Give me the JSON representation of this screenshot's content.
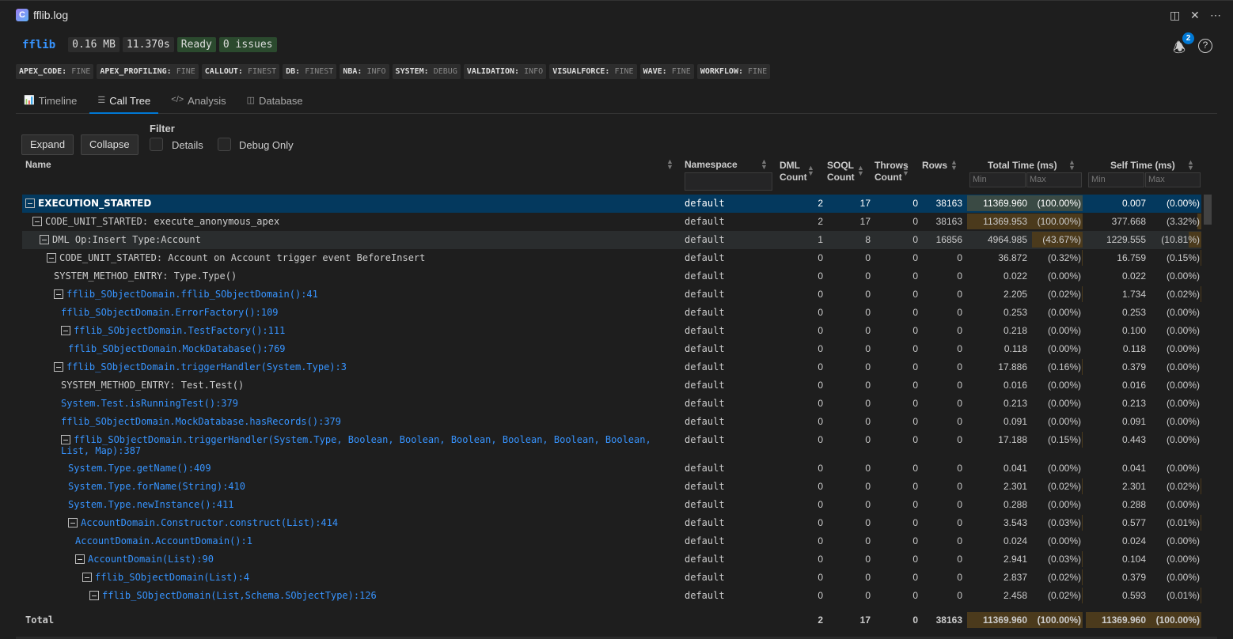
{
  "window": {
    "title": "fflib.log",
    "badge_count": "2"
  },
  "header": {
    "app": "fflib",
    "size": "0.16 MB",
    "duration": "11.370s",
    "status": "Ready",
    "issues": "0 issues"
  },
  "levels": [
    {
      "k": "APEX_CODE:",
      "v": "FINE"
    },
    {
      "k": "APEX_PROFILING:",
      "v": "FINE"
    },
    {
      "k": "CALLOUT:",
      "v": "FINEST"
    },
    {
      "k": "DB:",
      "v": "FINEST"
    },
    {
      "k": "NBA:",
      "v": "INFO"
    },
    {
      "k": "SYSTEM:",
      "v": "DEBUG"
    },
    {
      "k": "VALIDATION:",
      "v": "INFO"
    },
    {
      "k": "VISUALFORCE:",
      "v": "FINE"
    },
    {
      "k": "WAVE:",
      "v": "FINE"
    },
    {
      "k": "WORKFLOW:",
      "v": "FINE"
    }
  ],
  "tabs": [
    {
      "label": "Timeline",
      "icon": "chart-icon"
    },
    {
      "label": "Call Tree",
      "icon": "tree-icon",
      "active": true
    },
    {
      "label": "Analysis",
      "icon": "code-icon"
    },
    {
      "label": "Database",
      "icon": "database-icon"
    }
  ],
  "toolbar": {
    "expand": "Expand",
    "collapse": "Collapse",
    "filter": "Filter",
    "details": "Details",
    "debug_only": "Debug Only"
  },
  "columns": {
    "name": "Name",
    "namespace": "Namespace",
    "dml1": "DML",
    "dml2": "Count",
    "soql1": "SOQL",
    "soql2": "Count",
    "throws1": "Throws",
    "throws2": "Count",
    "rows": "Rows",
    "total": "Total Time (ms)",
    "self": "Self Time (ms)",
    "min": "Min",
    "max": "Max"
  },
  "colors": {
    "selected": "#04395e",
    "link": "#3794ff",
    "bar": "#4b3a1c"
  },
  "rows": [
    {
      "lvl": 0,
      "t": 1,
      "n": "EXECUTION_STARTED",
      "ns": "default",
      "dml": "2",
      "soql": "17",
      "thr": "0",
      "rows": "38163",
      "tt": "11369.960",
      "tp": "(100.00%)",
      "tpv": 100,
      "st": "0.007",
      "sp": "(0.00%)",
      "spv": 0,
      "sel": 1
    },
    {
      "lvl": 1,
      "t": 1,
      "n": "CODE_UNIT_STARTED: execute_anonymous_apex",
      "ns": "default",
      "dml": "2",
      "soql": "17",
      "thr": "0",
      "rows": "38163",
      "tt": "11369.953",
      "tp": "(100.00%)",
      "tpv": 100,
      "st": "377.668",
      "sp": "(3.32%)",
      "spv": 3.32
    },
    {
      "lvl": 2,
      "t": 1,
      "n": "DML Op:Insert Type:Account",
      "ns": "default",
      "dml": "1",
      "soql": "8",
      "thr": "0",
      "rows": "16856",
      "tt": "4964.985",
      "tp": "(43.67%)",
      "tpv": 43.67,
      "st": "1229.555",
      "sp": "(10.81%)",
      "spv": 10.81,
      "hov": 1
    },
    {
      "lvl": 3,
      "t": 1,
      "n": "CODE_UNIT_STARTED: Account on Account trigger event BeforeInsert",
      "ns": "default",
      "dml": "0",
      "soql": "0",
      "thr": "0",
      "rows": "0",
      "tt": "36.872",
      "tp": "(0.32%)",
      "tpv": 0.32,
      "st": "16.759",
      "sp": "(0.15%)",
      "spv": 0.15
    },
    {
      "lvl": 4,
      "t": 0,
      "n": "SYSTEM_METHOD_ENTRY: Type.Type()",
      "ns": "default",
      "dml": "0",
      "soql": "0",
      "thr": "0",
      "rows": "0",
      "tt": "0.022",
      "tp": "(0.00%)",
      "tpv": 0,
      "st": "0.022",
      "sp": "(0.00%)",
      "spv": 0
    },
    {
      "lvl": 4,
      "t": 1,
      "b": 1,
      "n": "fflib_SObjectDomain.fflib_SObjectDomain():41",
      "ns": "default",
      "dml": "0",
      "soql": "0",
      "thr": "0",
      "rows": "0",
      "tt": "2.205",
      "tp": "(0.02%)",
      "tpv": 0.02,
      "st": "1.734",
      "sp": "(0.02%)",
      "spv": 0.02
    },
    {
      "lvl": 5,
      "t": 0,
      "b": 1,
      "n": "fflib_SObjectDomain.ErrorFactory():109",
      "ns": "default",
      "dml": "0",
      "soql": "0",
      "thr": "0",
      "rows": "0",
      "tt": "0.253",
      "tp": "(0.00%)",
      "tpv": 0,
      "st": "0.253",
      "sp": "(0.00%)",
      "spv": 0
    },
    {
      "lvl": 5,
      "t": 1,
      "b": 1,
      "n": "fflib_SObjectDomain.TestFactory():111",
      "ns": "default",
      "dml": "0",
      "soql": "0",
      "thr": "0",
      "rows": "0",
      "tt": "0.218",
      "tp": "(0.00%)",
      "tpv": 0,
      "st": "0.100",
      "sp": "(0.00%)",
      "spv": 0
    },
    {
      "lvl": 6,
      "t": 0,
      "b": 1,
      "n": "fflib_SObjectDomain.MockDatabase():769",
      "ns": "default",
      "dml": "0",
      "soql": "0",
      "thr": "0",
      "rows": "0",
      "tt": "0.118",
      "tp": "(0.00%)",
      "tpv": 0,
      "st": "0.118",
      "sp": "(0.00%)",
      "spv": 0
    },
    {
      "lvl": 4,
      "t": 1,
      "b": 1,
      "n": "fflib_SObjectDomain.triggerHandler(System.Type):3",
      "ns": "default",
      "dml": "0",
      "soql": "0",
      "thr": "0",
      "rows": "0",
      "tt": "17.886",
      "tp": "(0.16%)",
      "tpv": 0.16,
      "st": "0.379",
      "sp": "(0.00%)",
      "spv": 0
    },
    {
      "lvl": 5,
      "t": 0,
      "n": "SYSTEM_METHOD_ENTRY: Test.Test()",
      "ns": "default",
      "dml": "0",
      "soql": "0",
      "thr": "0",
      "rows": "0",
      "tt": "0.016",
      "tp": "(0.00%)",
      "tpv": 0,
      "st": "0.016",
      "sp": "(0.00%)",
      "spv": 0
    },
    {
      "lvl": 5,
      "t": 0,
      "b": 1,
      "n": "System.Test.isRunningTest():379",
      "ns": "default",
      "dml": "0",
      "soql": "0",
      "thr": "0",
      "rows": "0",
      "tt": "0.213",
      "tp": "(0.00%)",
      "tpv": 0,
      "st": "0.213",
      "sp": "(0.00%)",
      "spv": 0
    },
    {
      "lvl": 5,
      "t": 0,
      "b": 1,
      "n": "fflib_SObjectDomain.MockDatabase.hasRecords():379",
      "ns": "default",
      "dml": "0",
      "soql": "0",
      "thr": "0",
      "rows": "0",
      "tt": "0.091",
      "tp": "(0.00%)",
      "tpv": 0,
      "st": "0.091",
      "sp": "(0.00%)",
      "spv": 0
    },
    {
      "lvl": 5,
      "t": 1,
      "b": 1,
      "tall": 1,
      "n": "fflib_SObjectDomain.triggerHandler(System.Type, Boolean, Boolean, Boolean, Boolean, Boolean, Boolean, List, Map):387",
      "ns": "default",
      "dml": "0",
      "soql": "0",
      "thr": "0",
      "rows": "0",
      "tt": "17.188",
      "tp": "(0.15%)",
      "tpv": 0.15,
      "st": "0.443",
      "sp": "(0.00%)",
      "spv": 0
    },
    {
      "lvl": 6,
      "t": 0,
      "b": 1,
      "n": "System.Type.getName():409",
      "ns": "default",
      "dml": "0",
      "soql": "0",
      "thr": "0",
      "rows": "0",
      "tt": "0.041",
      "tp": "(0.00%)",
      "tpv": 0,
      "st": "0.041",
      "sp": "(0.00%)",
      "spv": 0
    },
    {
      "lvl": 6,
      "t": 0,
      "b": 1,
      "n": "System.Type.forName(String):410",
      "ns": "default",
      "dml": "0",
      "soql": "0",
      "thr": "0",
      "rows": "0",
      "tt": "2.301",
      "tp": "(0.02%)",
      "tpv": 0.02,
      "st": "2.301",
      "sp": "(0.02%)",
      "spv": 0.02
    },
    {
      "lvl": 6,
      "t": 0,
      "b": 1,
      "n": "System.Type.newInstance():411",
      "ns": "default",
      "dml": "0",
      "soql": "0",
      "thr": "0",
      "rows": "0",
      "tt": "0.288",
      "tp": "(0.00%)",
      "tpv": 0,
      "st": "0.288",
      "sp": "(0.00%)",
      "spv": 0
    },
    {
      "lvl": 6,
      "t": 1,
      "b": 1,
      "n": "AccountDomain.Constructor.construct(List):414",
      "ns": "default",
      "dml": "0",
      "soql": "0",
      "thr": "0",
      "rows": "0",
      "tt": "3.543",
      "tp": "(0.03%)",
      "tpv": 0.03,
      "st": "0.577",
      "sp": "(0.01%)",
      "spv": 0.01
    },
    {
      "lvl": 7,
      "t": 0,
      "b": 1,
      "n": "AccountDomain.AccountDomain():1",
      "ns": "default",
      "dml": "0",
      "soql": "0",
      "thr": "0",
      "rows": "0",
      "tt": "0.024",
      "tp": "(0.00%)",
      "tpv": 0,
      "st": "0.024",
      "sp": "(0.00%)",
      "spv": 0
    },
    {
      "lvl": 7,
      "t": 1,
      "b": 1,
      "n": "AccountDomain(List):90",
      "ns": "default",
      "dml": "0",
      "soql": "0",
      "thr": "0",
      "rows": "0",
      "tt": "2.941",
      "tp": "(0.03%)",
      "tpv": 0.03,
      "st": "0.104",
      "sp": "(0.00%)",
      "spv": 0
    },
    {
      "lvl": 8,
      "t": 1,
      "b": 1,
      "n": "fflib_SObjectDomain(List):4",
      "ns": "default",
      "dml": "0",
      "soql": "0",
      "thr": "0",
      "rows": "0",
      "tt": "2.837",
      "tp": "(0.02%)",
      "tpv": 0.02,
      "st": "0.379",
      "sp": "(0.00%)",
      "spv": 0
    },
    {
      "lvl": 9,
      "t": 1,
      "b": 1,
      "n": "fflib_SObjectDomain(List,Schema.SObjectType):126",
      "ns": "default",
      "dml": "0",
      "soql": "0",
      "thr": "0",
      "rows": "0",
      "tt": "2.458",
      "tp": "(0.02%)",
      "tpv": 0.02,
      "st": "0.593",
      "sp": "(0.01%)",
      "spv": 0.01
    }
  ],
  "total": {
    "label": "Total",
    "dml": "2",
    "soql": "17",
    "thr": "0",
    "rows": "38163",
    "tt": "11369.960",
    "tp": "(100.00%)",
    "st": "11369.960",
    "sp": "(100.00%)"
  }
}
